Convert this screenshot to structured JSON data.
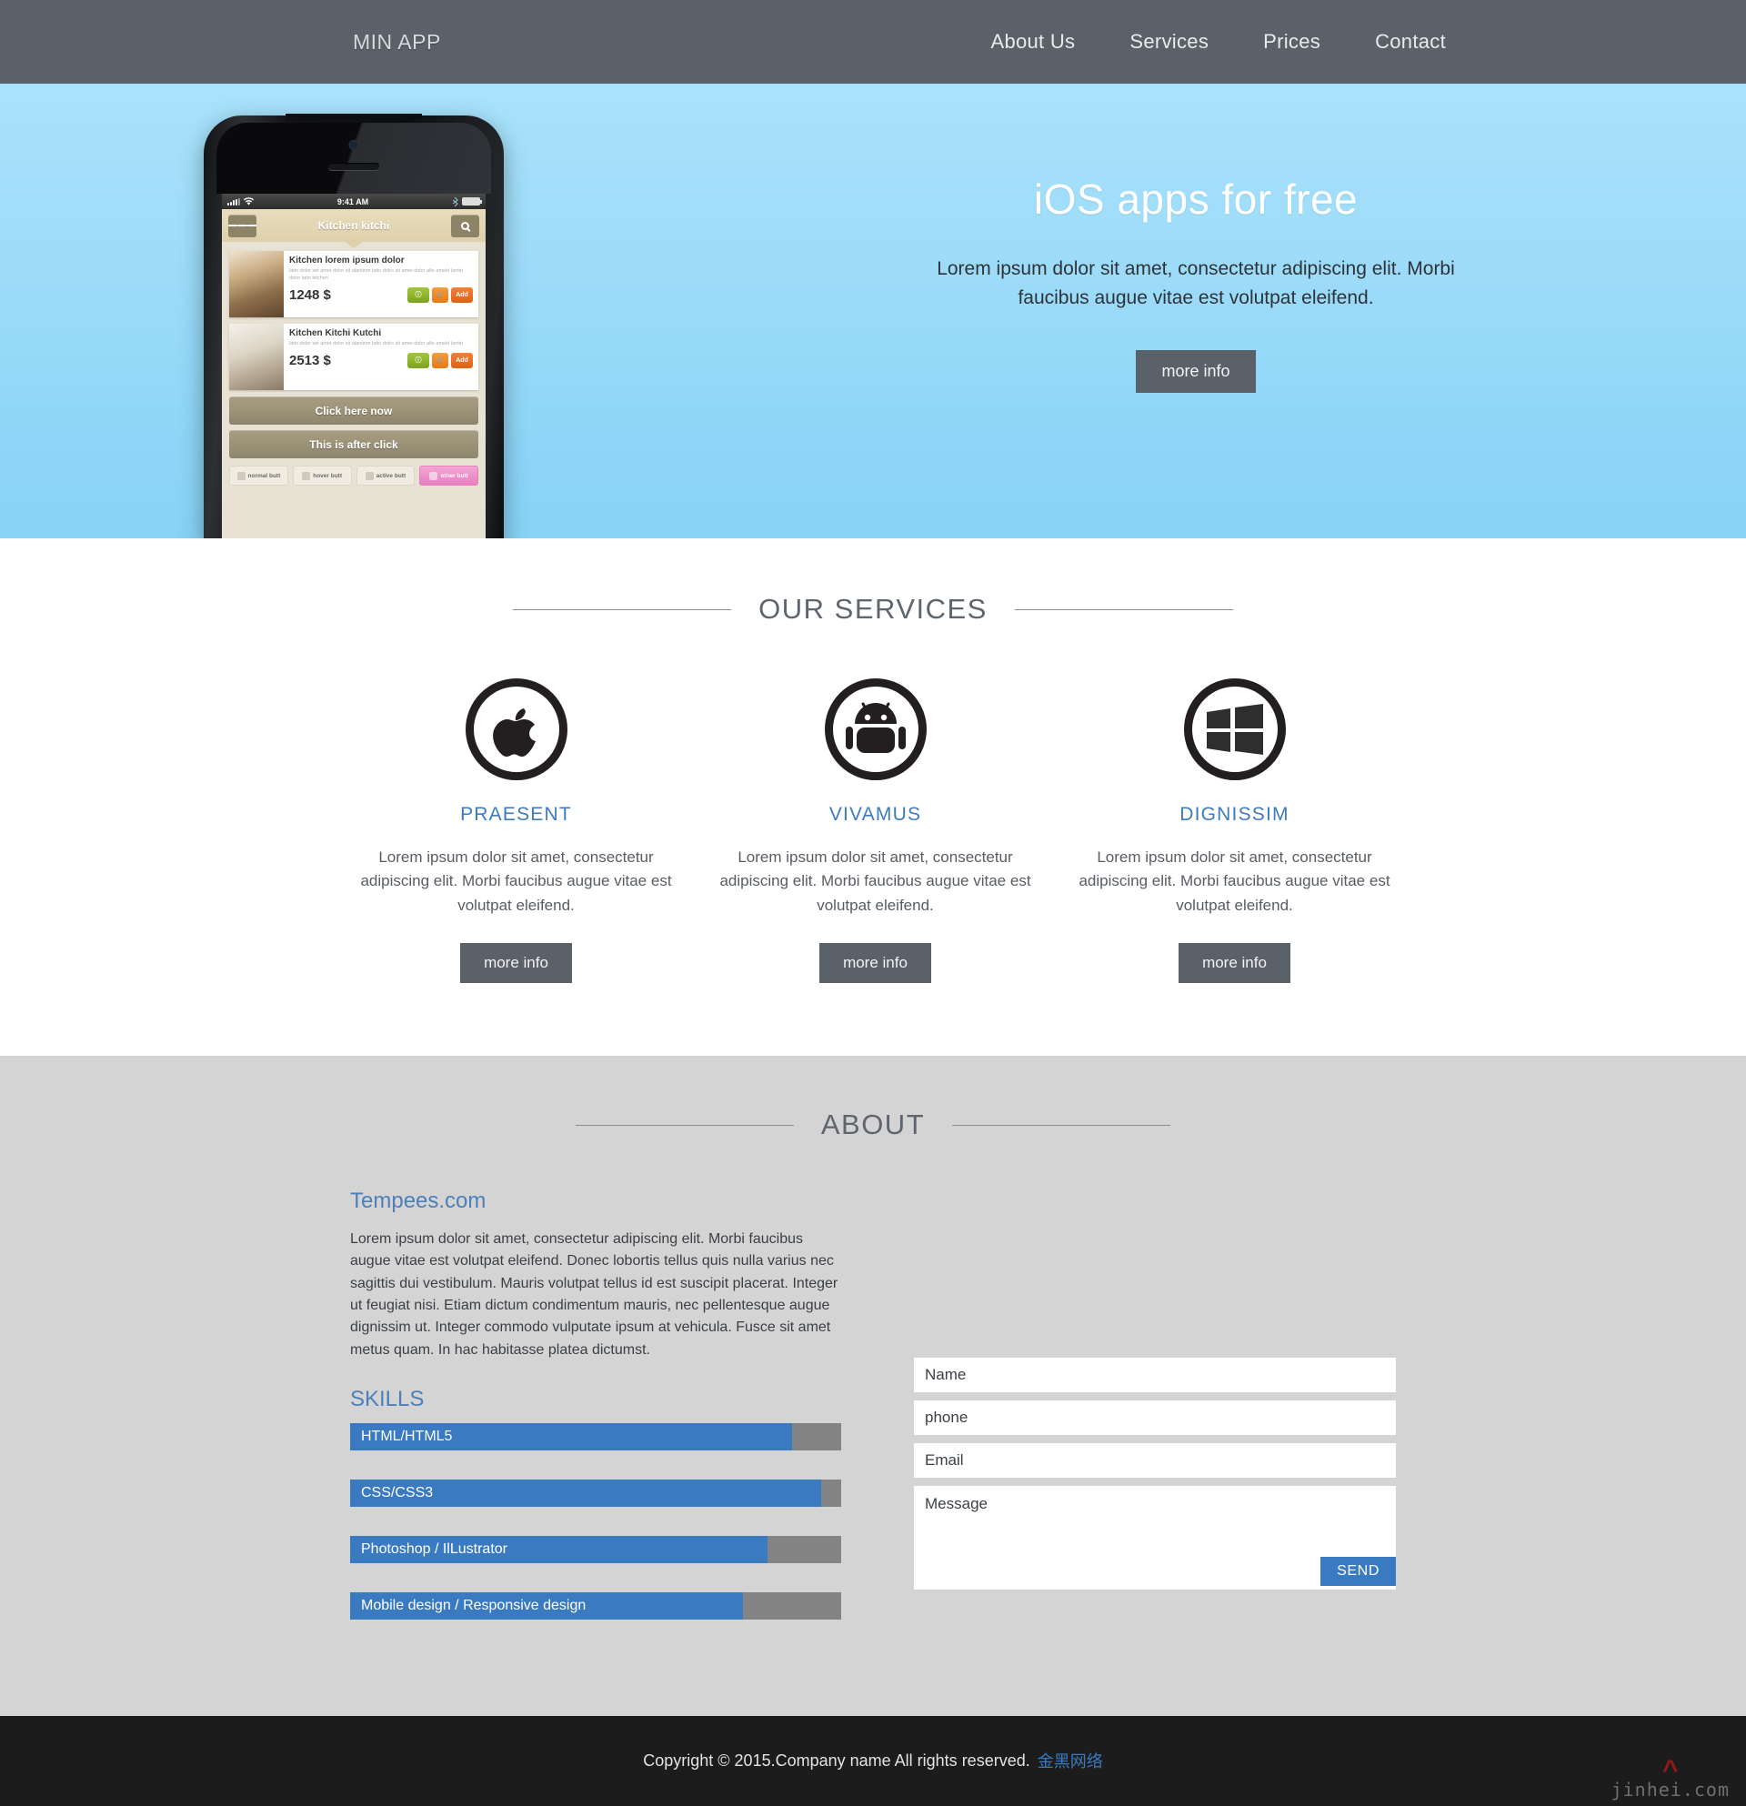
{
  "header": {
    "brand": "MIN APP",
    "nav": [
      {
        "label": "About Us"
      },
      {
        "label": "Services"
      },
      {
        "label": "Prices"
      },
      {
        "label": "Contact"
      }
    ]
  },
  "hero": {
    "title": "iOS apps for free",
    "subtitle": "Lorem ipsum dolor sit amet, consectetur adipiscing elit. Morbi faucibus augue vitae est volutpat eleifend.",
    "cta_label": "more info",
    "background_color": "#9ddcf9",
    "phone": {
      "status_time": "9:41 AM",
      "app_title": "Kitchen kitchi",
      "products": [
        {
          "title": "Kitchen lorem ipsum dolor",
          "desc": "latin dolor set amet dolor sit alantinm latin dolro sit amet dolor alte amekt lantin dolor latin kitchen",
          "price": "1248 $",
          "add_label": "Add"
        },
        {
          "title": "Kitchen Kitchi Kutchi",
          "desc": "latin dolor set amet dolor sit alantinm latin dolro sit amet dolor alte amekt lantin",
          "price": "2513 $",
          "add_label": "Add"
        }
      ],
      "wide_buttons": [
        "Click here now",
        "This is after click"
      ],
      "mini_buttons": [
        "normal butt",
        "hover butt",
        "active butt",
        "other butt"
      ]
    }
  },
  "services": {
    "section_title": "OUR SERVICES",
    "items": [
      {
        "icon": "apple-icon",
        "name": "PRAESENT",
        "desc": "Lorem ipsum dolor sit amet, consectetur adipiscing elit. Morbi faucibus augue vitae est volutpat eleifend.",
        "cta_label": "more info"
      },
      {
        "icon": "android-icon",
        "name": "VIVAMUS",
        "desc": "Lorem ipsum dolor sit amet, consectetur adipiscing elit. Morbi faucibus augue vitae est volutpat eleifend.",
        "cta_label": "more info"
      },
      {
        "icon": "windows-icon",
        "name": "DIGNISSIM",
        "desc": "Lorem ipsum dolor sit amet, consectetur adipiscing elit. Morbi faucibus augue vitae est volutpat eleifend.",
        "cta_label": "more info"
      }
    ]
  },
  "about": {
    "section_title": "ABOUT",
    "heading": "Tempees.com",
    "paragraph": "Lorem ipsum dolor sit amet, consectetur adipiscing elit. Morbi faucibus augue vitae est volutpat eleifend. Donec lobortis tellus quis nulla varius nec sagittis dui vestibulum. Mauris volutpat tellus id est suscipit placerat. Integer ut feugiat nisi. Etiam dictum condimentum mauris, nec pellentesque augue dignissim ut. Integer commodo vulputate ipsum at vehicula. Fusce sit amet metus quam. In hac habitasse platea dictumst.",
    "skills_heading": "SKILLS",
    "skills": [
      {
        "label": "HTML/HTML5",
        "percent": 90
      },
      {
        "label": "CSS/CSS3",
        "percent": 96
      },
      {
        "label": "Photoshop / IlLustrator",
        "percent": 85
      },
      {
        "label": "Mobile design / Responsive design",
        "percent": 80
      }
    ],
    "accent_color": "#3a7ac1"
  },
  "contact": {
    "name_placeholder": "Name",
    "phone_placeholder": "phone",
    "email_placeholder": "Email",
    "message_placeholder": "Message",
    "name_value": "",
    "phone_value": "",
    "email_value": "",
    "message_value": "",
    "send_label": "SEND"
  },
  "footer": {
    "copyright": "Copyright © 2015.Company name All rights reserved.",
    "link_label": "金黑网络",
    "watermark": "jinhei.com"
  }
}
